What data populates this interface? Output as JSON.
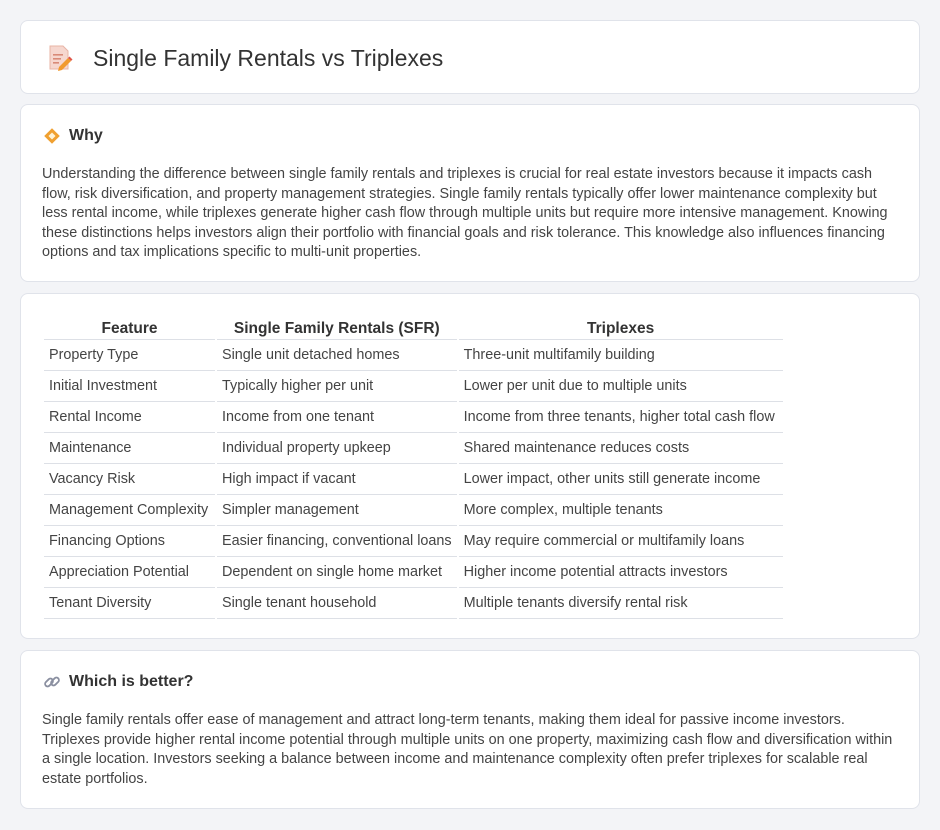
{
  "header": {
    "title": "Single Family Rentals vs Triplexes",
    "icon": "document-edit-icon"
  },
  "why": {
    "title": "Why",
    "icon": "diamond-icon",
    "text": "Understanding the difference between single family rentals and triplexes is crucial for real estate investors because it impacts cash flow, risk diversification, and property management strategies. Single family rentals typically offer lower maintenance complexity but less rental income, while triplexes generate higher cash flow through multiple units but require more intensive management. Knowing these distinctions helps investors align their portfolio with financial goals and risk tolerance. This knowledge also influences financing options and tax implications specific to multi-unit properties."
  },
  "table": {
    "headers": [
      "Feature",
      "Single Family Rentals (SFR)",
      "Triplexes"
    ],
    "rows": [
      [
        "Property Type",
        "Single unit detached homes",
        "Three-unit multifamily building"
      ],
      [
        "Initial Investment",
        "Typically higher per unit",
        "Lower per unit due to multiple units"
      ],
      [
        "Rental Income",
        "Income from one tenant",
        "Income from three tenants, higher total cash flow"
      ],
      [
        "Maintenance",
        "Individual property upkeep",
        "Shared maintenance reduces costs"
      ],
      [
        "Vacancy Risk",
        "High impact if vacant",
        "Lower impact, other units still generate income"
      ],
      [
        "Management Complexity",
        "Simpler management",
        "More complex, multiple tenants"
      ],
      [
        "Financing Options",
        "Easier financing, conventional loans",
        "May require commercial or multifamily loans"
      ],
      [
        "Appreciation Potential",
        "Dependent on single home market",
        "Higher income potential attracts investors"
      ],
      [
        "Tenant Diversity",
        "Single tenant household",
        "Multiple tenants diversify rental risk"
      ]
    ]
  },
  "better": {
    "title": "Which is better?",
    "icon": "link-icon",
    "text": "Single family rentals offer ease of management and attract long-term tenants, making them ideal for passive income investors. Triplexes provide higher rental income potential through multiple units on one property, maximizing cash flow and diversification within a single location. Investors seeking a balance between income and maintenance complexity often prefer triplexes for scalable real estate portfolios."
  },
  "colors": {
    "background": "#f3f4f7",
    "card": "#ffffff",
    "border": "#e0e3ea",
    "accent": "#f0a030"
  }
}
